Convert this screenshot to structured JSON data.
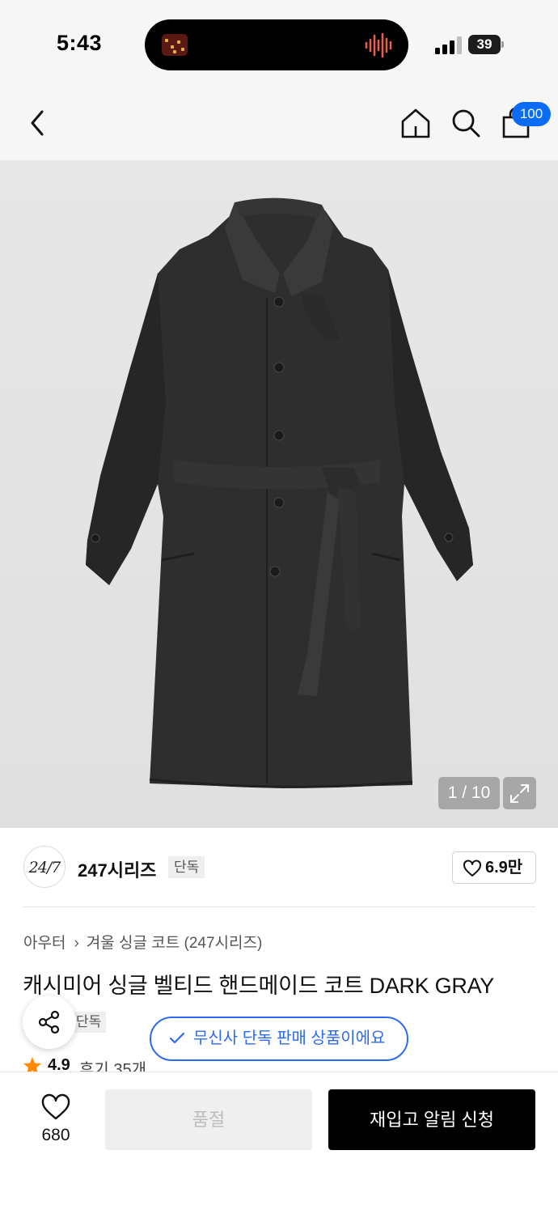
{
  "status_bar": {
    "time": "5:43",
    "battery": "39"
  },
  "header": {
    "icons": [
      "back-icon",
      "home-icon",
      "search-icon",
      "shopping-bag-icon"
    ],
    "cart_badge": "100"
  },
  "gallery": {
    "counter": "1 / 10"
  },
  "brand": {
    "logo_text": "24/7",
    "name": "247시리즈",
    "exclusive_tag": "단독",
    "likes": "6.9만"
  },
  "product": {
    "breadcrumb": [
      "아우터",
      "겨울 싱글 코트 (247시리즈)"
    ],
    "title": "캐시미어 싱글 벨티드 핸드메이드 코트 DARK GRAY",
    "badge": "단독",
    "exclusive_notice": "무신사 단독 판매 상품이에요",
    "rating": "4.9",
    "review_label": "후기 35개"
  },
  "bottom_bar": {
    "wish_count": "680",
    "soldout_label": "품절",
    "restock_label": "재입고 알림 신청"
  },
  "colors": {
    "accent_blue": "#2c6bf1",
    "badge_blue": "#0a6cf5",
    "star": "#ff8a00"
  }
}
